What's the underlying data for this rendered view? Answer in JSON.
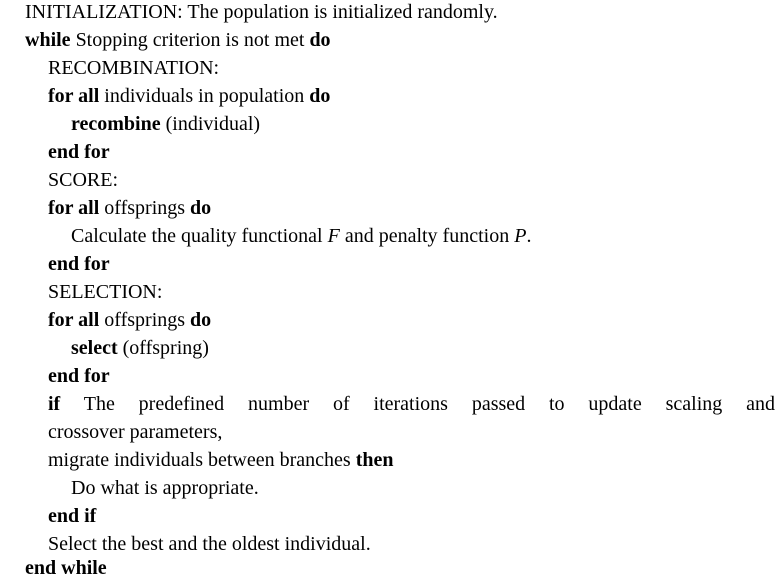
{
  "lines": {
    "l1": {
      "text": "INITIALIZATION: The population is initialized randomly."
    },
    "l2": {
      "kw1": "while",
      "text": " Stopping criterion is not met ",
      "kw2": "do"
    },
    "l3": {
      "text": "RECOMBINATION:"
    },
    "l4": {
      "kw1": "for all",
      "text": " individuals in population ",
      "kw2": "do"
    },
    "l5": {
      "kw1": "recombine",
      "text": " (individual)"
    },
    "l6": {
      "kw1": "end for"
    },
    "l7": {
      "text": "SCORE:"
    },
    "l8": {
      "kw1": "for all",
      "text": " offsprings ",
      "kw2": "do"
    },
    "l9": {
      "text1": "Calculate the quality functional ",
      "var1": "F",
      "text2": " and penalty function ",
      "var2": "P",
      "text3": "."
    },
    "l10": {
      "kw1": "end for"
    },
    "l11": {
      "text": "SELECTION:"
    },
    "l12": {
      "kw1": "for all",
      "text": " offsprings ",
      "kw2": "do"
    },
    "l13": {
      "kw1": "select",
      "text": " (offspring)"
    },
    "l14": {
      "kw1": "end for"
    },
    "l15": {
      "kw1": "if",
      "text": " The predefined number of iterations passed to update scaling and"
    },
    "l16": {
      "text": "crossover parameters,"
    },
    "l17": {
      "text": "migrate individuals between branches ",
      "kw2": "then"
    },
    "l18": {
      "text": "Do what is appropriate."
    },
    "l19": {
      "kw1": "end if"
    },
    "l20": {
      "text": "Select the best and the oldest individual."
    },
    "l21": {
      "kw1": "end while"
    }
  }
}
